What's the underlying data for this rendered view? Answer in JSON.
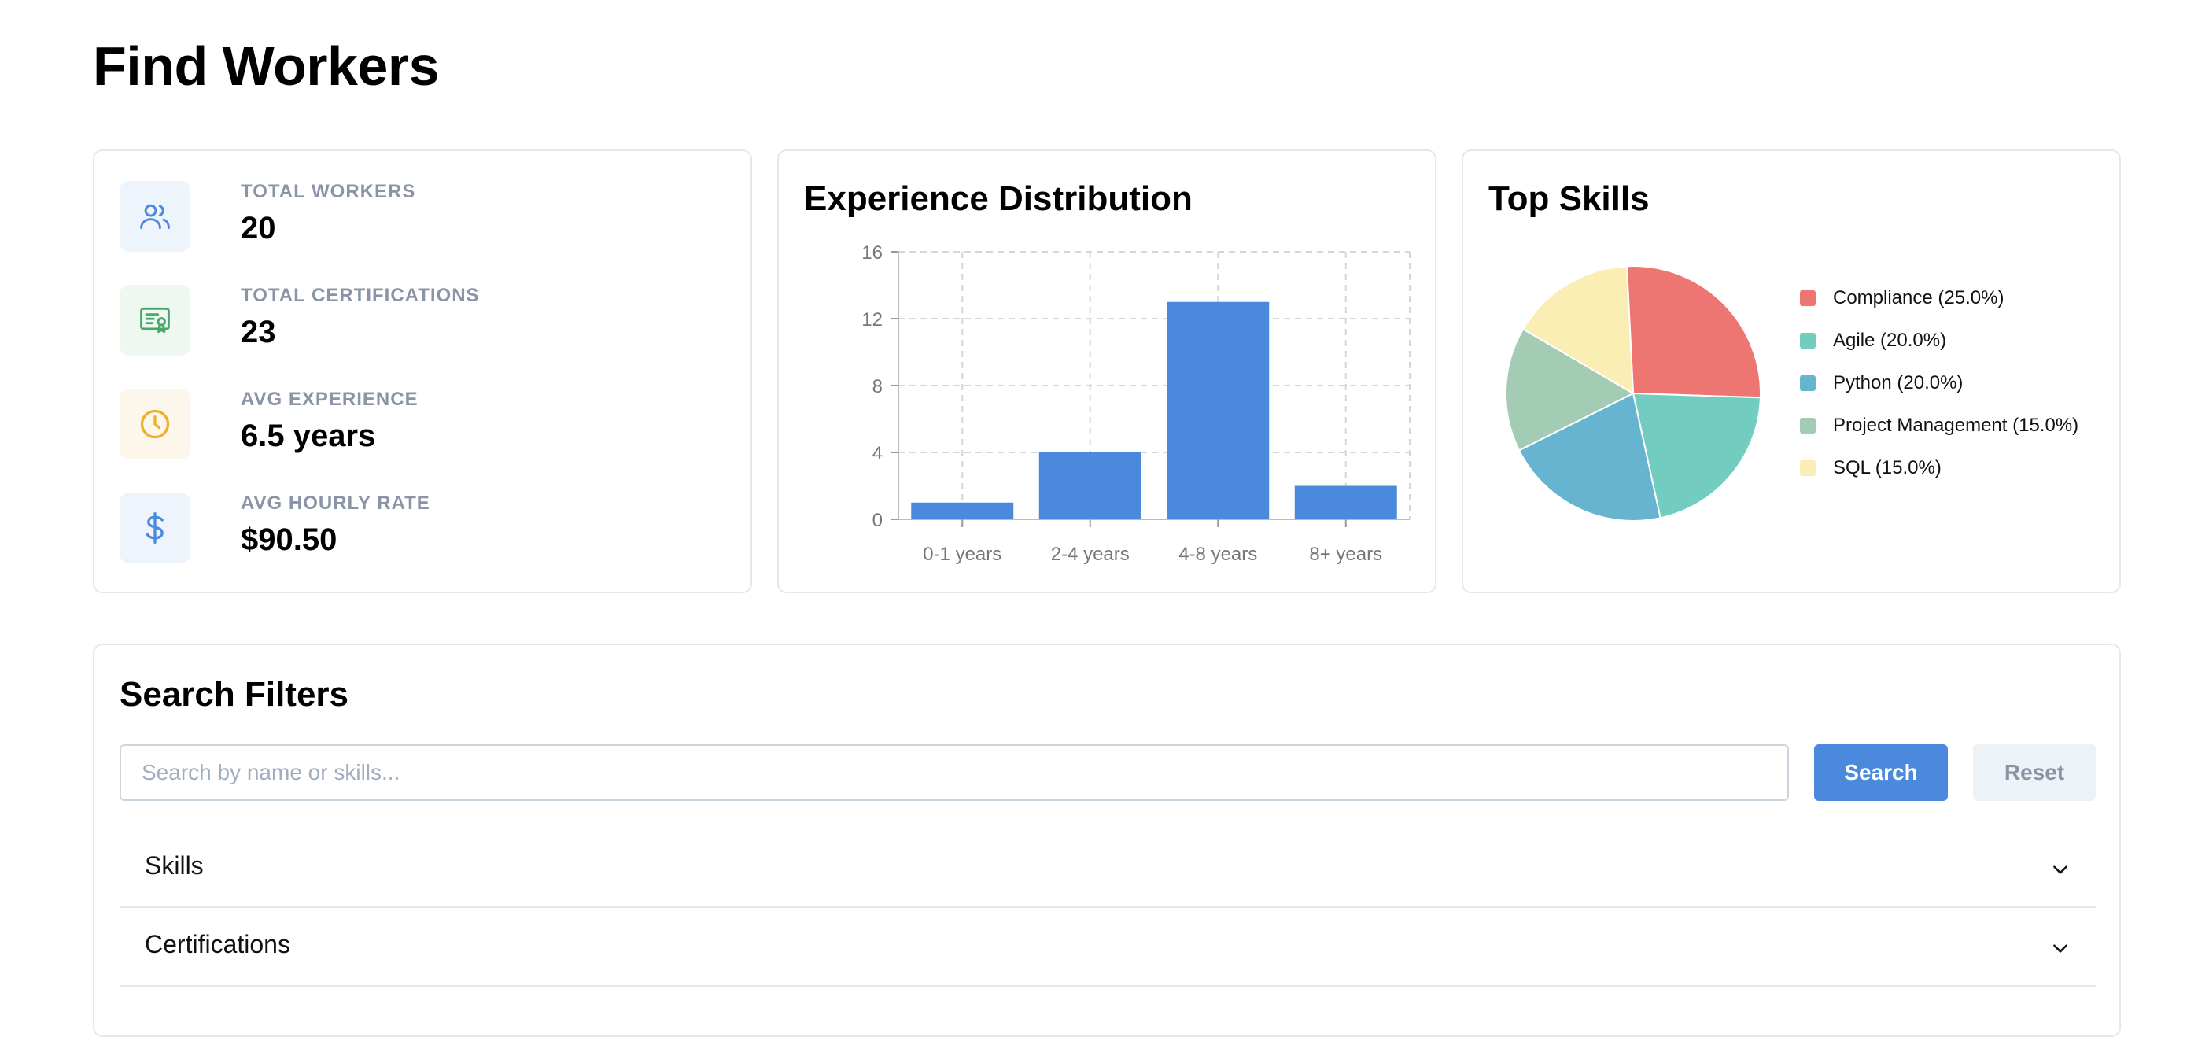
{
  "page": {
    "title": "Find Workers"
  },
  "stats": [
    {
      "label": "Total Workers",
      "value": "20",
      "icon": "users-icon",
      "color": "#4a89dc",
      "bg": "#eef4fc"
    },
    {
      "label": "Total Certifications",
      "value": "23",
      "icon": "certificate-icon",
      "color": "#48a868",
      "bg": "#eef8f1"
    },
    {
      "label": "Avg Experience",
      "value": "6.5 years",
      "icon": "clock-icon",
      "color": "#ecb02e",
      "bg": "#fdf6ea"
    },
    {
      "label": "Avg Hourly Rate",
      "value": "$90.50",
      "icon": "dollar-icon",
      "color": "#4a89dc",
      "bg": "#eef4fc"
    }
  ],
  "experience": {
    "title": "Experience Distribution"
  },
  "skills": {
    "title": "Top Skills",
    "legend": [
      "Compliance (25.0%)",
      "Agile (20.0%)",
      "Python (20.0%)",
      "Project Management (15.0%)",
      "SQL (15.0%)"
    ]
  },
  "filters": {
    "title": "Search Filters",
    "search_placeholder": "Search by name or skills...",
    "search_label": "Search",
    "reset_label": "Reset",
    "sections": [
      "Skills",
      "Certifications"
    ]
  },
  "chart_data": [
    {
      "type": "bar",
      "title": "Experience Distribution",
      "categories": [
        "0-1 years",
        "2-4 years",
        "4-8 years",
        "8+ years"
      ],
      "values": [
        1,
        4,
        13,
        2
      ],
      "ylim": [
        0,
        16
      ],
      "yticks": [
        0,
        4,
        8,
        12,
        16
      ],
      "grid": true,
      "color": "#4a89dc"
    },
    {
      "type": "pie",
      "title": "Top Skills",
      "labels": [
        "Compliance",
        "Agile",
        "Python",
        "Project Management",
        "SQL"
      ],
      "values": [
        25.0,
        20.0,
        20.0,
        15.0,
        15.0
      ],
      "colors": [
        "#ee7672",
        "#72ccc0",
        "#66b4d0",
        "#a4cbb4",
        "#fbeeb4"
      ],
      "legend": "right"
    }
  ]
}
